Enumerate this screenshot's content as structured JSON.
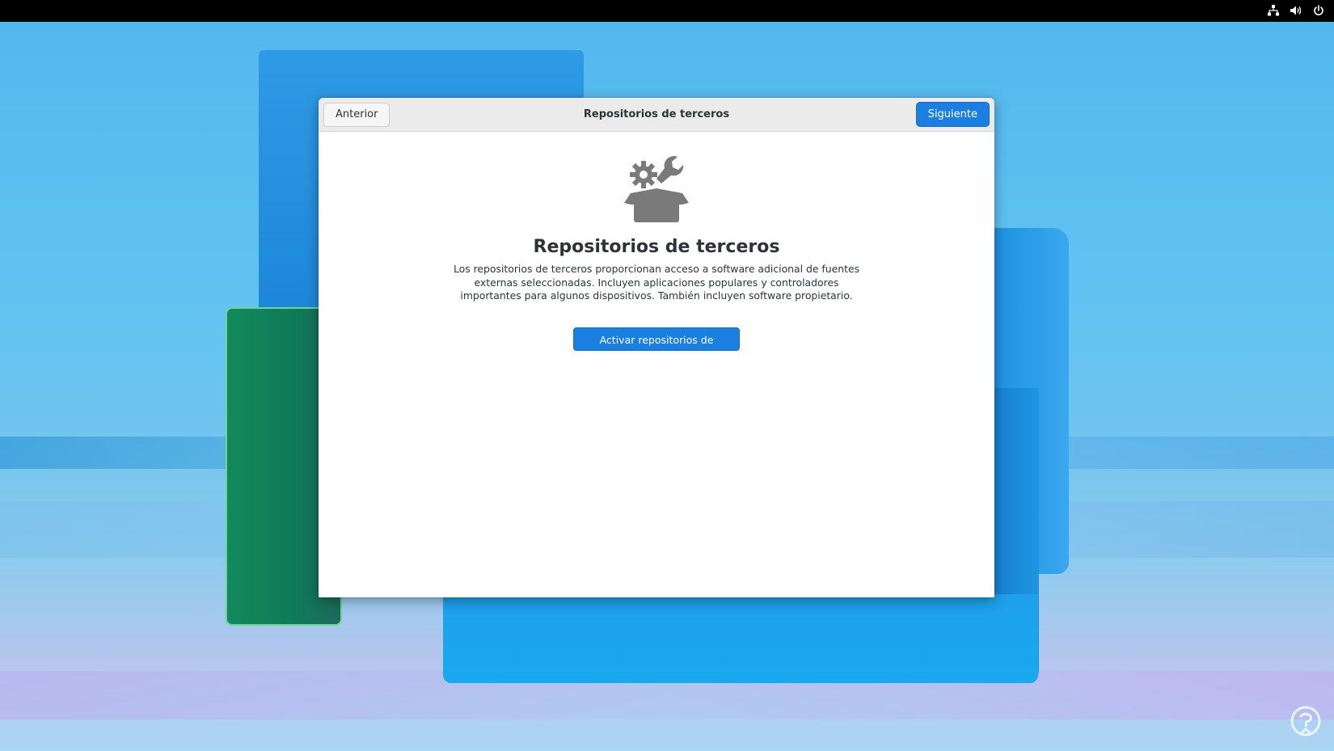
{
  "window": {
    "title": "Repositorios de terceros",
    "prev_label": "Anterior",
    "next_label": "Siguiente"
  },
  "page": {
    "heading": "Repositorios de terceros",
    "description": "Los repositorios de terceros proporcionan acceso a software adicional de fuentes externas seleccionadas. Incluyen aplicaciones populares y controladores importantes para algunos dispositivos. También incluyen software propietario.",
    "enable_button_label": "Activar repositorios de terceros",
    "hero_icon": "software-repository-icon"
  },
  "tray": {
    "icons": [
      "network-wired-icon",
      "volume-icon",
      "power-icon"
    ]
  },
  "colors": {
    "accent": "#1a7fe0",
    "header_bg": "#ebebeb",
    "text": "#2e3436"
  }
}
